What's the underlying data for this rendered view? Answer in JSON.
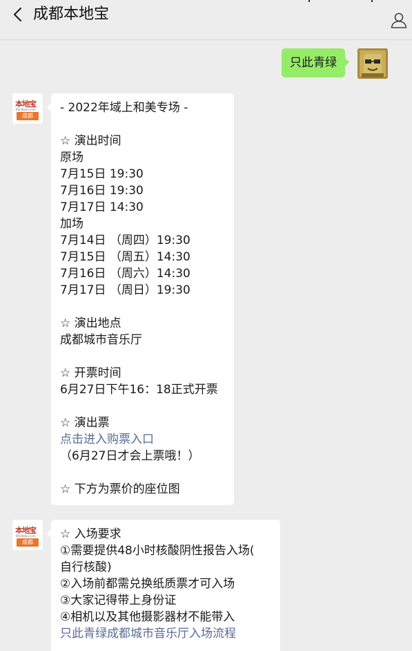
{
  "header": {
    "title": "成都本地宝"
  },
  "my_message": {
    "text": "只此青绿"
  },
  "brand_logo": {
    "top": "本地宝",
    "mid": "Bendibao.com",
    "bottom": "成都"
  },
  "message1": {
    "lines": [
      "- 2022年域上和美专场 -",
      "",
      "☆ 演出时间",
      "原场",
      "7月15日 19:30",
      "7月16日 19:30",
      "7月17日 14:30",
      "加场",
      "7月14日 （周四）19:30",
      "7月15日 （周五）14:30",
      "7月16日 （周六）14:30",
      "7月17日 （周日）19:30",
      "",
      "☆ 演出地点",
      "成都城市音乐厅",
      "",
      "☆ 开票时间",
      "6月27日下午16：18正式开票",
      "",
      "☆ 演出票"
    ],
    "link_text": "点击进入购票入口",
    "after_link": "（6月27日才会上票哦！）",
    "blank": "",
    "last_line": "☆ 下方为票价的座位图"
  },
  "message2": {
    "lines": [
      "☆ 入场要求",
      "①需要提供48小时核酸阴性报告入场(",
      "自行核酸)",
      "②入场前都需兑换纸质票才可入场",
      "③大家记得带上身份证",
      "④相机以及其他摄影器材不能带入"
    ],
    "link_text": "只此青绿成都城市音乐厅入场流程"
  },
  "colors": {
    "background": "#ededed",
    "my_bubble": "#95ec69",
    "link": "#576b95",
    "brand_orange": "#e8762b",
    "brand_red": "#c0392b"
  },
  "icons": {
    "back": "chevron-left-icon",
    "profile": "user-icon"
  }
}
